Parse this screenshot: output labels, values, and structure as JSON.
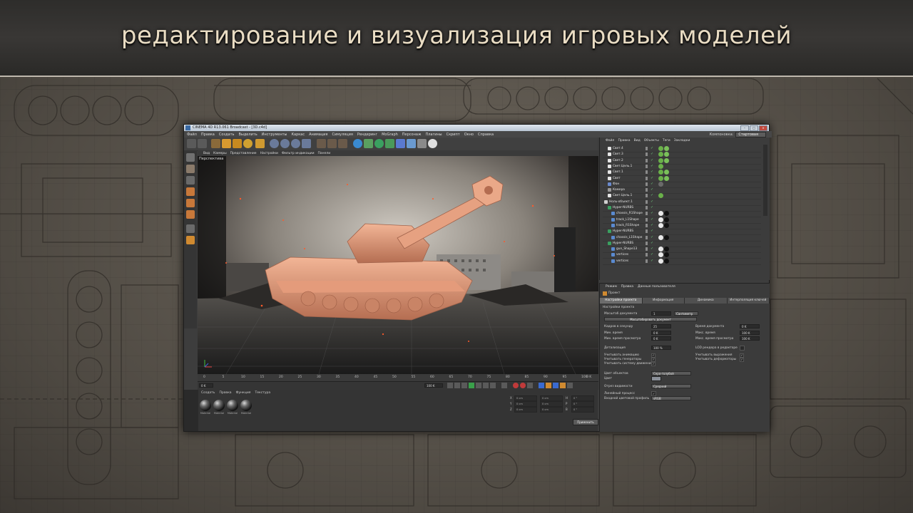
{
  "banner": {
    "title": "редактирование и визуализация игровых моделей"
  },
  "window": {
    "title": "CINEMA 4D R13.061 Broadcast - [3D.c4d]",
    "menu": [
      "Файл",
      "Правка",
      "Создать",
      "Выделить",
      "Инструменты",
      "Каркас",
      "Анимация",
      "Симуляция",
      "Рендеринг",
      "MoGraph",
      "Персонаж",
      "Плагины",
      "Скрипт",
      "Окно",
      "Справка"
    ],
    "layout_label": "Компоновка:",
    "layout_value": "Стартовая"
  },
  "viewport": {
    "menu": [
      "Вид",
      "Камеры",
      "Представление",
      "Настройки",
      "Фильтр индикации",
      "Панели"
    ],
    "label": "Перспектива"
  },
  "timeline": {
    "ticks": [
      "0",
      "5",
      "10",
      "15",
      "20",
      "25",
      "30",
      "35",
      "40",
      "45",
      "50",
      "55",
      "60",
      "65",
      "70",
      "75",
      "80",
      "85",
      "90",
      "95",
      "100"
    ],
    "frame_end_label": "0 K",
    "start_field": "0 K",
    "end_field": "100 K"
  },
  "materials": {
    "menu": [
      "Создать",
      "Правка",
      "Функция",
      "Текстура"
    ],
    "items": [
      "Material",
      "Material",
      "Material",
      "Material"
    ]
  },
  "coords": {
    "labels": [
      "X",
      "Y",
      "Z",
      "H",
      "P",
      "B"
    ],
    "values": [
      "0 cm",
      "0 cm",
      "0 cm",
      "0 cm",
      "0 cm",
      "0 cm",
      "0 °",
      "0 °",
      "0 °"
    ],
    "apply": "Применить"
  },
  "object_manager": {
    "menu": [
      "Файл",
      "Правка",
      "Вид",
      "Объекты",
      "Теги",
      "Закладки"
    ],
    "rows": [
      {
        "name": "Свет.4",
        "indent": 1,
        "icon": "light"
      },
      {
        "name": "Свет.3",
        "indent": 1,
        "icon": "light"
      },
      {
        "name": "Свет.2",
        "indent": 1,
        "icon": "light"
      },
      {
        "name": "Свет.Цель.1",
        "indent": 1,
        "icon": "target"
      },
      {
        "name": "Свет.1",
        "indent": 1,
        "icon": "light"
      },
      {
        "name": "Свет",
        "indent": 1,
        "icon": "light"
      },
      {
        "name": "Фон",
        "indent": 1,
        "icon": "bg"
      },
      {
        "name": "Камера",
        "indent": 1,
        "icon": "camera"
      },
      {
        "name": "Свет.Цель.1",
        "indent": 1,
        "icon": "target"
      },
      {
        "name": "Ноль-объект.1",
        "indent": 0,
        "icon": "null"
      },
      {
        "name": "Hyper-NURBS",
        "indent": 1,
        "icon": "nurbs"
      },
      {
        "name": "chassis_R1Shape",
        "indent": 2,
        "icon": "poly"
      },
      {
        "name": "track_L1Shape",
        "indent": 2,
        "icon": "poly"
      },
      {
        "name": "track_R1Shape",
        "indent": 2,
        "icon": "poly"
      },
      {
        "name": "Hyper-NURBS",
        "indent": 1,
        "icon": "nurbs"
      },
      {
        "name": "chassis_L1Shape",
        "indent": 2,
        "icon": "poly"
      },
      {
        "name": "Hyper-NURBS",
        "indent": 1,
        "icon": "nurbs"
      },
      {
        "name": "gun_Shape13",
        "indent": 2,
        "icon": "poly"
      },
      {
        "name": "vertices",
        "indent": 2,
        "icon": "poly"
      },
      {
        "name": "vertices",
        "indent": 2,
        "icon": "poly"
      }
    ]
  },
  "attributes": {
    "menu": [
      "Режим",
      "Правка",
      "Данные пользователя"
    ],
    "object": "Проект",
    "tabs": [
      "Настройки проекта",
      "Информация",
      "Динамика",
      "Интерполяция ключей"
    ],
    "section": "Настройки проекта",
    "scale_label": "Масштаб документа",
    "scale_value": "1",
    "scale_unit": "Сантиметр",
    "scale_button": "Масштабировать документ",
    "left": [
      {
        "label": "Кадров в секунду",
        "value": "25"
      },
      {
        "label": "Мин. время",
        "value": "0 K"
      },
      {
        "label": "Мин. время просмотра",
        "value": "0 K"
      },
      {
        "label": "Детализация",
        "value": "100 %"
      }
    ],
    "right": [
      {
        "label": "Время документа",
        "value": "0 K"
      },
      {
        "label": "Макс. время",
        "value": "100 K"
      },
      {
        "label": "Макс. время просмотра",
        "value": "100 K"
      },
      {
        "label": "LOD рендера в редакторе",
        "value": ""
      }
    ],
    "checks_left": [
      "Учитывать анимацию",
      "Учитывать генераторы",
      "Учитывать систему движения"
    ],
    "checks_right": [
      "Учитывать выражения",
      "Учитывать деформаторы"
    ],
    "object_color_label": "Цвет объектов",
    "object_color_value": "Серо-голубой",
    "color_label": "Цвет",
    "clip_label": "Отрез видимости",
    "clip_value": "Средний",
    "linear_label": "Линейный процесс",
    "profile_label": "Входной цветовой профиль",
    "profile_value": "sRGB"
  }
}
